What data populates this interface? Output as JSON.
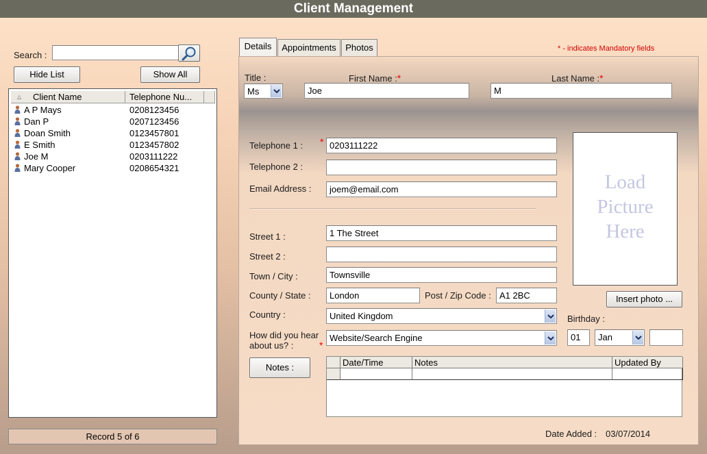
{
  "window": {
    "title": "Client Management"
  },
  "sidebar": {
    "search_label": "Search :",
    "search_value": "",
    "hide_list_label": "Hide List",
    "show_all_label": "Show All",
    "columns": [
      "Client Name",
      "Telephone Nu..."
    ],
    "clients": [
      {
        "name": "A P Mays",
        "phone": "0208123456"
      },
      {
        "name": "Dan P",
        "phone": "0207123456"
      },
      {
        "name": "Doan Smith",
        "phone": "0123457801"
      },
      {
        "name": "E Smith",
        "phone": "0123457802"
      },
      {
        "name": "Joe M",
        "phone": "0203111222"
      },
      {
        "name": "Mary Cooper",
        "phone": "0208654321"
      }
    ],
    "record_status": "Record 5 of 6"
  },
  "tabs": [
    "Details",
    "Appointments",
    "Photos"
  ],
  "mandatory_note": "* - indicates Mandatory fields",
  "form": {
    "title_label": "Title :",
    "title_value": "Ms",
    "first_name_label": "First Name :",
    "first_name_value": "Joe",
    "last_name_label": "Last Name :",
    "last_name_value": "M",
    "telephone1_label": "Telephone 1 :",
    "telephone1_value": "0203111222",
    "telephone2_label": "Telephone 2 :",
    "telephone2_value": "",
    "email_label": "Email Address :",
    "email_value": "joem@email.com",
    "street1_label": "Street 1 :",
    "street1_value": "1 The Street",
    "street2_label": "Street 2 :",
    "street2_value": "",
    "town_label": "Town / City :",
    "town_value": "Townsville",
    "county_label": "County / State :",
    "county_value": "London",
    "postcode_label": "Post / Zip Code :",
    "postcode_value": "A1 2BC",
    "country_label": "Country :",
    "country_value": "United Kingdom",
    "heard_label_line1": "How did you hear",
    "heard_label_line2": "about us? :",
    "heard_value": "Website/Search Engine",
    "picture_placeholder": [
      "Load",
      "Picture",
      "Here"
    ],
    "insert_photo_label": "Insert photo ...",
    "birthday_label": "Birthday :",
    "birthday_day": "01",
    "birthday_month": "Jan",
    "birthday_year": "",
    "notes_button_label": "Notes :",
    "notes_columns": [
      "Date/Time",
      "Notes",
      "Updated By"
    ],
    "date_added_label": "Date Added :",
    "date_added_value": "03/07/2014",
    "required_marker": "*"
  },
  "colors": {
    "titlebar": "#6b6a5e",
    "required": "#e00000",
    "photo_placeholder_text": "#c4c6e0"
  }
}
